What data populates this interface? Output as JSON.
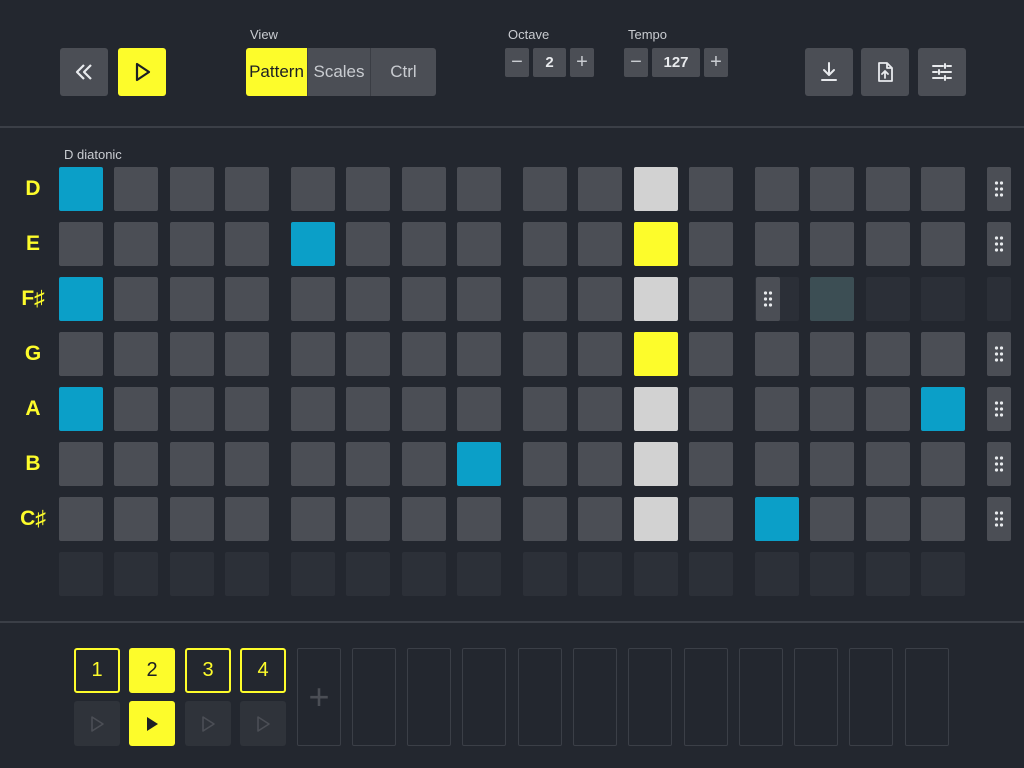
{
  "toolbar": {
    "rewind_icon": "rewind-icon",
    "play_icon": "play-icon",
    "view": {
      "label": "View",
      "options": [
        "Pattern",
        "Scales",
        "Ctrl"
      ],
      "selected": "Pattern"
    },
    "octave": {
      "label": "Octave",
      "value": "2",
      "minus": "−",
      "plus": "+"
    },
    "tempo": {
      "label": "Tempo",
      "value": "127",
      "minus": "−",
      "plus": "+"
    },
    "actions": [
      "download-icon",
      "export-file-icon",
      "sliders-icon"
    ]
  },
  "grid": {
    "scale_name": "D diatonic",
    "notes": [
      "D",
      "E",
      "F♯",
      "G",
      "A",
      "B",
      "C♯"
    ],
    "rows": [
      "o.........c.....",
      "....o.....y.....",
      "o.........c.....",
      "..........y.....",
      "o.........c....o.",
      ".......o..c.....",
      "..........c.o..."
    ],
    "colors": {
      "active": "#0b9fc8",
      "playhead": "#fdfc2b",
      "current_column": "#d2d2d2",
      "off": "#4b4e55"
    }
  },
  "patterns": {
    "items": [
      {
        "label": "1",
        "active": false
      },
      {
        "label": "2",
        "active": true
      },
      {
        "label": "3",
        "active": false
      },
      {
        "label": "4",
        "active": false
      }
    ],
    "add_label": "+"
  }
}
